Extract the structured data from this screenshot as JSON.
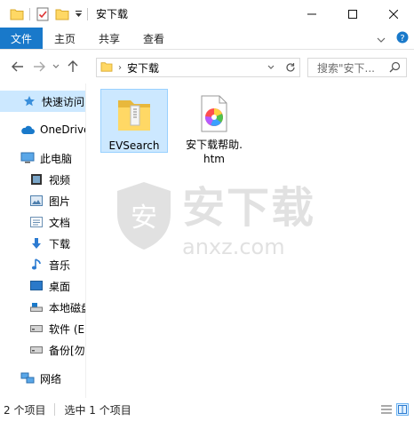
{
  "window": {
    "title": "安下载",
    "minimize_symbol": "—",
    "maximize_symbol": "☐",
    "close_symbol": "✕"
  },
  "ribbon": {
    "tabs": [
      "文件",
      "主页",
      "共享",
      "查看"
    ],
    "accent": "#1979ca"
  },
  "address": {
    "path": "安下载",
    "search_placeholder": "搜索\"安下..."
  },
  "nav_pane": {
    "items": [
      {
        "label": "快速访问",
        "icon": "star-icon"
      },
      {
        "label": "OneDrive",
        "icon": "cloud-icon"
      },
      {
        "label": "此电脑",
        "icon": "computer-icon"
      },
      {
        "label": "视频",
        "icon": "video-icon"
      },
      {
        "label": "图片",
        "icon": "picture-icon"
      },
      {
        "label": "文档",
        "icon": "document-icon"
      },
      {
        "label": "下载",
        "icon": "download-icon"
      },
      {
        "label": "音乐",
        "icon": "music-icon"
      },
      {
        "label": "桌面",
        "icon": "desktop-icon"
      },
      {
        "label": "本地磁盘",
        "icon": "drive-icon"
      },
      {
        "label": "软件 (E",
        "icon": "drive-icon"
      },
      {
        "label": "备份[勿",
        "icon": "drive-icon"
      },
      {
        "label": "网络",
        "icon": "network-icon"
      }
    ]
  },
  "files": [
    {
      "name": "EVSearch",
      "icon": "folder-icon"
    },
    {
      "name": "安下载帮助.htm",
      "icon": "html-file-icon"
    }
  ],
  "watermark": {
    "text_cn": "安下载",
    "text_en": "anxz.com"
  },
  "status": {
    "count": "2 个项目",
    "selection": "选中 1 个项目"
  }
}
